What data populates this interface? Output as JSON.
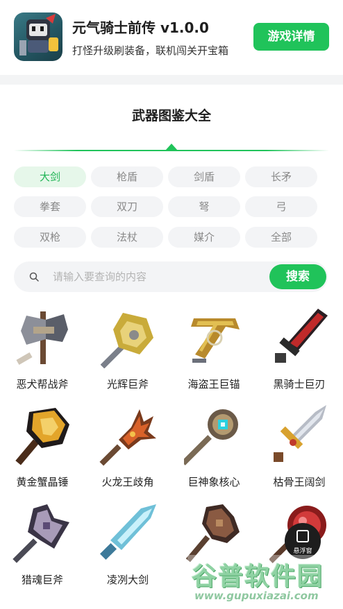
{
  "header": {
    "app_title": "元气骑士前传 v1.0.0",
    "app_subtitle": "打怪升级刷装备，联机闯关开宝箱",
    "detail_button": "游戏详情"
  },
  "section_title": "武器图鉴大全",
  "categories": [
    {
      "label": "大剑",
      "active": true
    },
    {
      "label": "枪盾"
    },
    {
      "label": "剑盾"
    },
    {
      "label": "长矛"
    },
    {
      "label": "拳套"
    },
    {
      "label": "双刀"
    },
    {
      "label": "弩"
    },
    {
      "label": "弓"
    },
    {
      "label": "双枪"
    },
    {
      "label": "法杖"
    },
    {
      "label": "媒介"
    },
    {
      "label": "全部"
    }
  ],
  "search": {
    "placeholder": "请输入要查询的内容",
    "button": "搜索"
  },
  "weapons": [
    {
      "name": "恶犬帮战斧",
      "icon": "axe-icon"
    },
    {
      "name": "光辉巨斧",
      "icon": "axe-icon"
    },
    {
      "name": "海盗王巨锚",
      "icon": "anchor-icon"
    },
    {
      "name": "黑骑士巨刃",
      "icon": "sword-icon"
    },
    {
      "name": "黄金蟹晶锤",
      "icon": "hammer-icon"
    },
    {
      "name": "火龙王歧角",
      "icon": "antler-icon"
    },
    {
      "name": "巨神象核心",
      "icon": "staff-icon"
    },
    {
      "name": "枯骨王阔剑",
      "icon": "sword-icon"
    },
    {
      "name": "猎魂巨斧",
      "icon": "axe-icon"
    },
    {
      "name": "凌冽大剑",
      "icon": "sword-icon"
    },
    {
      "name": "",
      "icon": "axe-icon"
    },
    {
      "name": "",
      "icon": "mace-icon"
    }
  ],
  "float_button": {
    "label": "悬浮窗",
    "icon": "window-icon"
  },
  "watermark": {
    "brand": "谷普软件园",
    "url": "www.gupuxiazai.com"
  },
  "colors": {
    "accent": "#20c35a",
    "chip_bg": "#f3f4f6",
    "chip_active_bg": "#e6f7ea",
    "text_gray": "#8a8a8a"
  }
}
